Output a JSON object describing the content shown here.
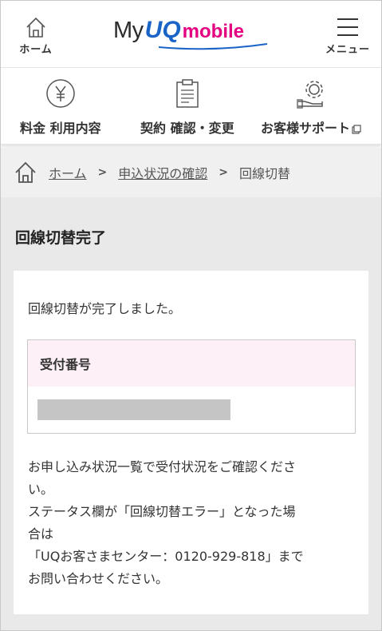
{
  "header": {
    "home_label": "ホーム",
    "logo": {
      "my": "My",
      "uq": "UQ",
      "mobile": "mobile"
    },
    "menu_label": "メニュー"
  },
  "nav": {
    "items": [
      {
        "label": "料金 利用内容",
        "icon": "yen-icon"
      },
      {
        "label": "契約 確認・変更",
        "icon": "clipboard-icon"
      },
      {
        "label": "お客様サポート",
        "icon": "gear-hand-icon",
        "external": true
      }
    ]
  },
  "breadcrumb": {
    "items": [
      "ホーム",
      "申込状況の確認"
    ],
    "current": "回線切替",
    "separator": ">"
  },
  "main": {
    "title": "回線切替完了",
    "complete_message": "回線切替が完了しました。",
    "receipt_label": "受付番号",
    "notice_lines": [
      "お申し込み状況一覧で受付状況をご確認くださ",
      "い。",
      "ステータス欄が「回線切替エラー」となった場",
      "合は",
      "「UQお客さまセンター：0120-929-818」まで",
      "お問い合わせください。"
    ]
  },
  "colors": {
    "brand_blue": "#1a64c8",
    "brand_pink": "#e4007f",
    "receipt_header_bg": "#fdf0f6",
    "page_bg": "#e9e9e9"
  }
}
